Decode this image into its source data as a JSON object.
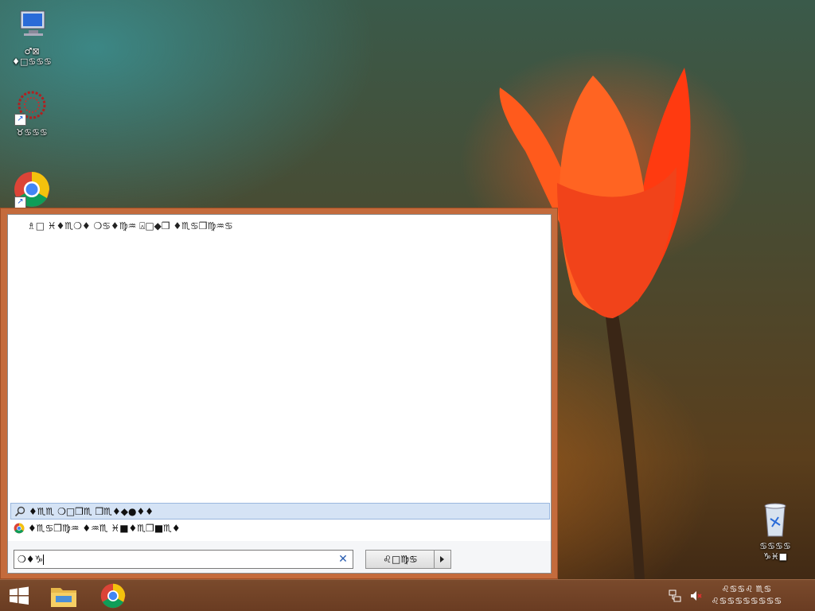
{
  "desktop": {
    "icons": [
      {
        "name": "computer",
        "label_line1": "♂⊠",
        "label_line2": "♦□♋♋♋"
      },
      {
        "name": "app-shortcut",
        "label": "♉♋♋♋"
      },
      {
        "name": "chrome-shortcut",
        "label": ""
      },
      {
        "name": "recycle-bin",
        "label_line1": "♋♋♋♋",
        "label_line2": "♑♓■"
      }
    ]
  },
  "dialog": {
    "header": "♗□ ♓♦♏❍♦ ❍♋♦♍♒ ⍓□◆❒ ♦♏♋❒♍♒♋",
    "suggestions": [
      {
        "icon": "search-icon",
        "text": "♦♏♏ ❍□❒♏ ❒♏♦◆●♦♦",
        "selected": true
      },
      {
        "icon": "chrome-icon",
        "text": "♦♏♋❒♍♒ ♦♒♏ ♓■♦♏❒■♏♦",
        "selected": false
      }
    ],
    "search": {
      "value": "❍♦♑",
      "placeholder": ""
    },
    "search_button_label": "♌□♍♋"
  },
  "taskbar": {
    "apps": [
      "start",
      "file-explorer",
      "chrome"
    ],
    "clock": {
      "line1": "♌♋♋♌ ♏♋",
      "line2": "♌♋♋♋♋♋♋♋♋"
    }
  },
  "colors": {
    "dialog_frame": "#c46b3c",
    "selected_bg": "#d5e3f5",
    "taskbar": "#6a3c22"
  }
}
